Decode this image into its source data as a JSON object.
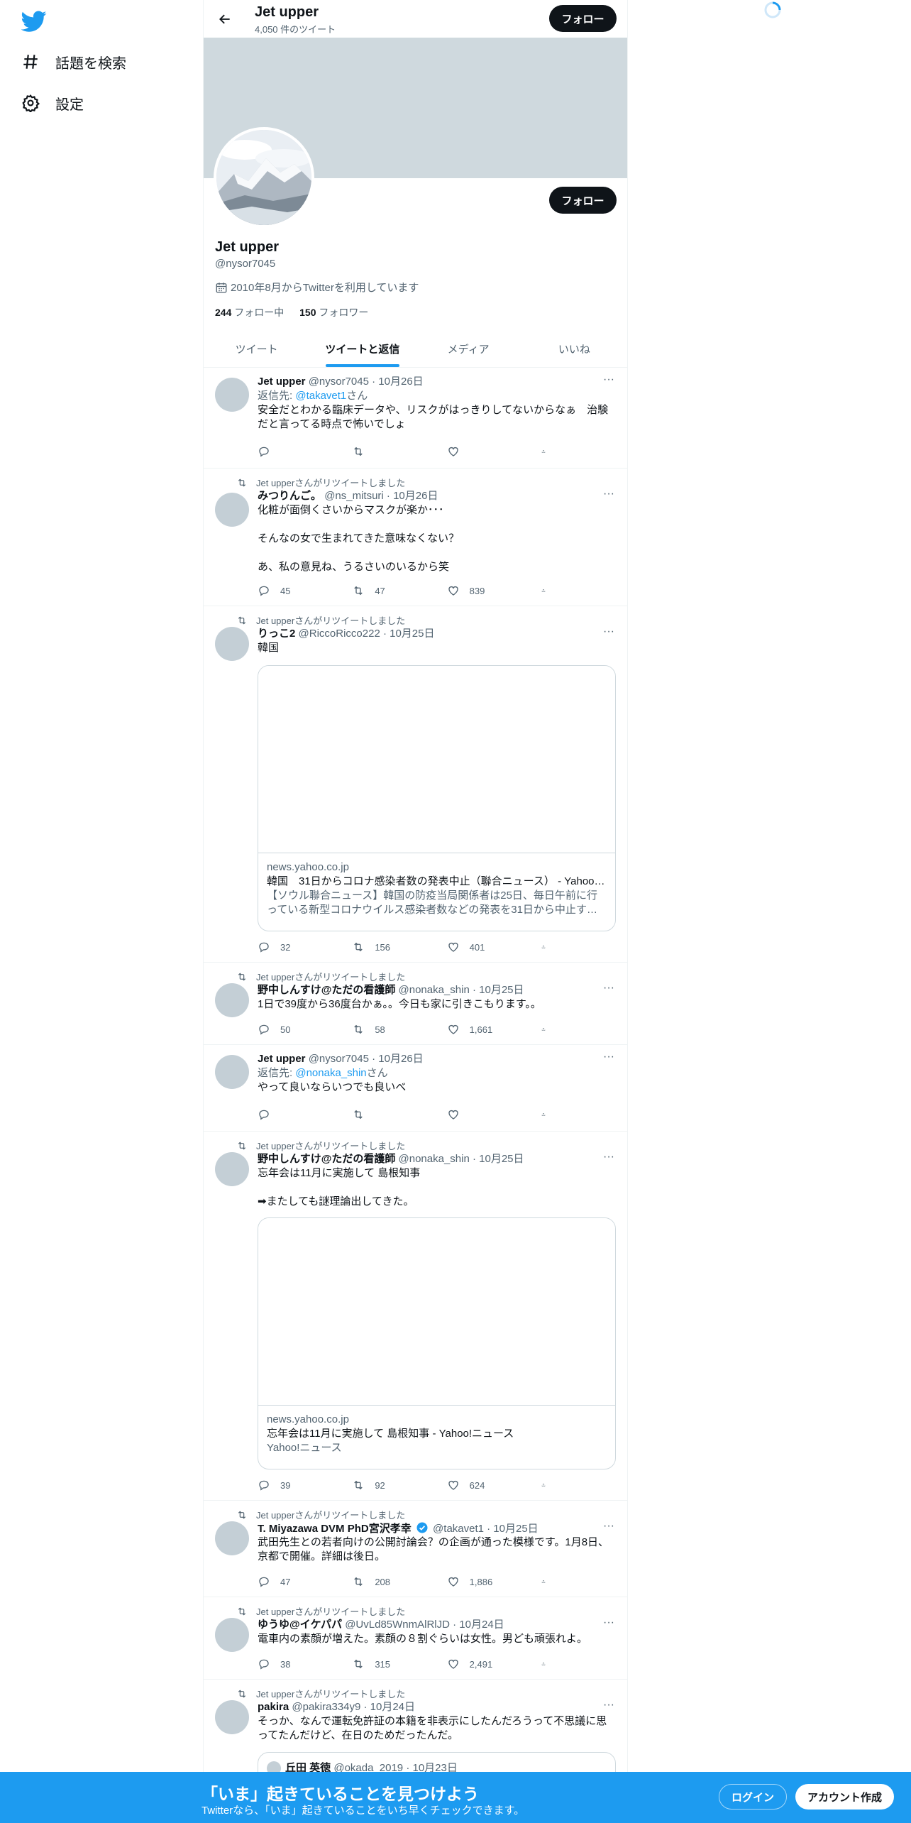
{
  "nav": {
    "explore_label": "話題を検索",
    "settings_label": "設定"
  },
  "header": {
    "name": "Jet upper",
    "tweet_count": "4,050 件のツイート",
    "follow_label": "フォロー"
  },
  "profile": {
    "name": "Jet upper",
    "handle": "@nysor7045",
    "joined": "2010年8月からTwitterを利用しています",
    "following_count": "244",
    "following_label": "フォロー中",
    "followers_count": "150",
    "followers_label": "フォロワー",
    "follow_label": "フォロー"
  },
  "tabs": [
    "ツイート",
    "ツイートと返信",
    "メディア",
    "いいね"
  ],
  "tweets": [
    {
      "retweet_label": "",
      "name": "Jet upper",
      "meta": "@nysor7045 · 10月26日",
      "reply_prefix": "返信先: ",
      "reply_mention": "@takavet1",
      "reply_suffix": "さん",
      "text": "安全だとわかる臨床データや、リスクがはっきりしてないからなぁ　治験だと言ってる時点で怖いでしょ",
      "replies": "",
      "retweets": "",
      "likes": ""
    },
    {
      "retweet_label": "Jet upperさんがリツイートしました",
      "name": "みつりんご。",
      "meta": "@ns_mitsuri · 10月26日",
      "text": "化粧が面倒くさいからマスクが楽か･･･\n\nそんなの女で生まれてきた意味なくない？\n\nあ、私の意見ね、うるさいのいるから笑",
      "replies": "45",
      "retweets": "47",
      "likes": "839"
    },
    {
      "retweet_label": "Jet upperさんがリツイートしました",
      "name": "りっこ2",
      "meta": "@RiccoRicco222 · 10月25日",
      "text": "韓国",
      "card_domain": "news.yahoo.co.jp",
      "card_title": "韓国　31日からコロナ感染者数の発表中止（聯合ニュース） - Yahoo!ニュース",
      "card_desc": "【ソウル聯合ニュース】韓国の防疫当局関係者は25日、毎日午前に行っている新型コロナウイルス感染者数などの発表を31日から中止する方針を示した。",
      "replies": "32",
      "retweets": "156",
      "likes": "401"
    },
    {
      "retweet_label": "Jet upperさんがリツイートしました",
      "name": "野中しんすけ@ただの看護師",
      "meta": "@nonaka_shin · 10月25日",
      "text": "1日で39度から36度台かぁ。。今日も家に引きこもります。。",
      "replies": "50",
      "retweets": "58",
      "likes": "1,661"
    },
    {
      "retweet_label": "",
      "name": "Jet upper",
      "meta": "@nysor7045 · 10月26日",
      "reply_prefix": "返信先: ",
      "reply_mention": "@nonaka_shin",
      "reply_suffix": "さん",
      "text": "やって良いならいつでも良いべ",
      "replies": "",
      "retweets": "",
      "likes": ""
    },
    {
      "retweet_label": "Jet upperさんがリツイートしました",
      "name": "野中しんすけ@ただの看護師",
      "meta": "@nonaka_shin · 10月25日",
      "text": "忘年会は11月に実施して 島根知事\n\n➡またしても謎理論出してきた。",
      "card_domain": "news.yahoo.co.jp",
      "card_title": "忘年会は11月に実施して 島根知事 - Yahoo!ニュース",
      "card_desc": "Yahoo!ニュース",
      "replies": "39",
      "retweets": "92",
      "likes": "624"
    },
    {
      "retweet_label": "Jet upperさんがリツイートしました",
      "name": "T. Miyazawa DVM PhD宮沢孝幸",
      "meta": "@takavet1 · 10月25日",
      "text": "武田先生との若者向けの公開討論会？の企画が通った模様です。1月8日、京都で開催。詳細は後日。",
      "replies": "47",
      "retweets": "208",
      "likes": "1,886"
    },
    {
      "retweet_label": "Jet upperさんがリツイートしました",
      "name": "ゆうゆ@イケパパ",
      "meta": "@UvLd85WnmAlRlJD · 10月24日",
      "text": "電車内の素顔が増えた。素顔の８割ぐらいは女性。男ども頑張れよ。",
      "replies": "38",
      "retweets": "315",
      "likes": "2,491"
    },
    {
      "retweet_label": "Jet upperさんがリツイートしました",
      "name": "pakira",
      "meta": "@pakira334y9 · 10月24日",
      "text": "そっか、なんで運転免許証の本籍を非表示にしたんだろうって不思議に思ってたんだけど、在日のためだったんだ。",
      "quote_name": "丘田 英徳",
      "quote_meta": "@okada_2019 · 10月23日"
    }
  ],
  "bottom": {
    "title": "「いま」起きていることを見つけよう",
    "subtitle": "Twitterなら、「いま」起きていることをいち早くチェックできます。",
    "login_label": "ログイン",
    "signup_label": "アカウント作成"
  },
  "colors": {
    "accent": "#1d9bf0",
    "banner": "#cfd9de",
    "text": "#0f1419",
    "muted": "#536471"
  }
}
